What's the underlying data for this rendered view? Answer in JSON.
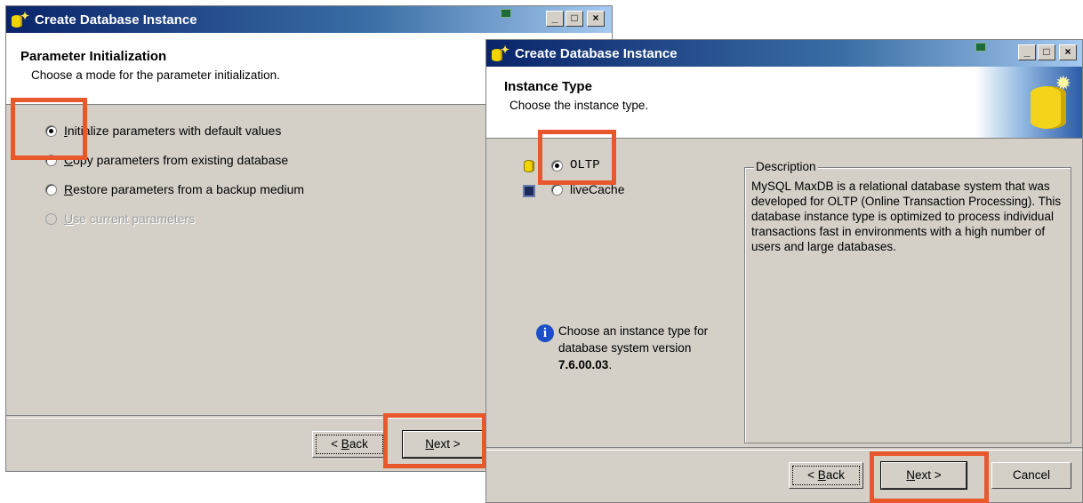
{
  "window1": {
    "title": "Create Database Instance",
    "header_title": "Parameter Initialization",
    "header_subtitle": "Choose a mode for the parameter initialization.",
    "options": [
      {
        "first": "I",
        "rest": "nitialize parameters with default values"
      },
      {
        "first": "C",
        "rest": "opy parameters from existing database"
      },
      {
        "first": "R",
        "rest": "estore parameters from a backup medium"
      },
      {
        "first": "U",
        "rest": "se current parameters"
      }
    ],
    "back_first": "B",
    "back_prefix": "< ",
    "back_rest": "ack",
    "next_first": "N",
    "next_rest": "ext >"
  },
  "window2": {
    "title": "Create Database Instance",
    "header_title": "Instance Type",
    "header_subtitle": "Choose the instance type.",
    "option_oltp": "OLTP",
    "option_livecache": "liveCache",
    "info_line1": "Choose an instance type for",
    "info_line2": "database system version",
    "info_version": "7.6.00.03",
    "info_period": ".",
    "description_label": "Description",
    "description_text": "MySQL MaxDB is a relational database system that was developed for OLTP (Online Transaction Processing). This database instance type is optimized to process individual transactions fast in environments with a high number of users and large databases.",
    "back_prefix": "< ",
    "back_first": "B",
    "back_rest": "ack",
    "next_first": "N",
    "next_rest": "ext >",
    "cancel_label": "Cancel"
  },
  "titlebar_buttons": {
    "minimize": "_",
    "maximize": "□",
    "close": "×"
  },
  "colors": {
    "highlight": "#e8582b",
    "title_start": "#0a246a",
    "title_end": "#a6caf0",
    "dialog_face": "#d4d0c8"
  }
}
